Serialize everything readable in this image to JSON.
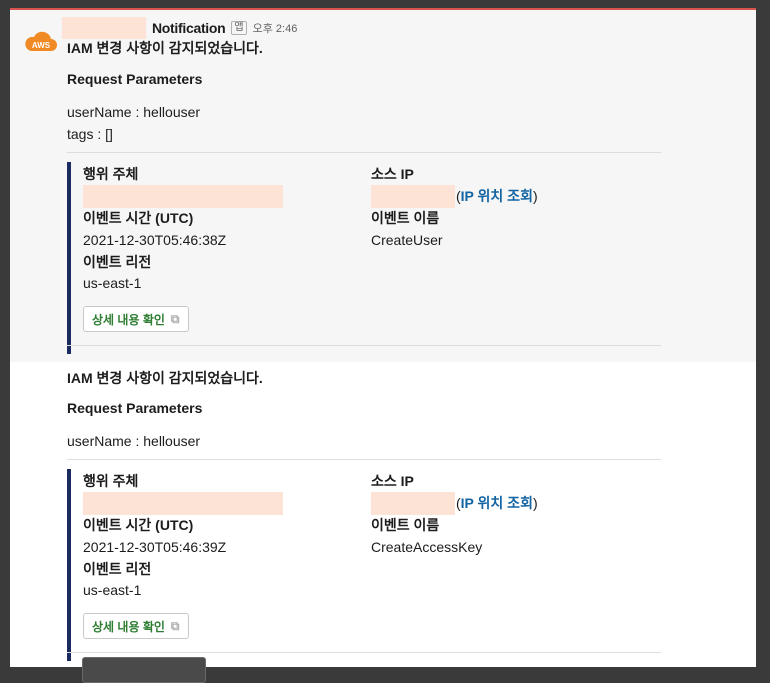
{
  "header": {
    "app_name": "Notification",
    "app_badge": "앱",
    "timestamp": "오후 2:46"
  },
  "avatar": {
    "label": "AWS"
  },
  "messages": [
    {
      "title": "IAM 변경 사항이 감지되었습니다.",
      "params_heading": "Request Parameters",
      "param_lines": [
        "userName : hellouser",
        "tags : []"
      ],
      "fields": {
        "actor_label": "행위 주체",
        "source_ip_label": "소스 IP",
        "ip_lookup_link": "IP 위치 조회",
        "event_time_label": "이벤트 시간 (UTC)",
        "event_time_value": "2021-12-30T05:46:38Z",
        "event_name_label": "이벤트 이름",
        "event_name_value": "CreateUser",
        "event_region_label": "이벤트 리전",
        "event_region_value": "us-east-1"
      },
      "detail_button": "상세 내용 확인"
    },
    {
      "title": "IAM 변경 사항이 감지되었습니다.",
      "params_heading": "Request Parameters",
      "param_lines": [
        "userName : hellouser"
      ],
      "fields": {
        "actor_label": "행위 주체",
        "source_ip_label": "소스 IP",
        "ip_lookup_link": "IP 위치 조회",
        "event_time_label": "이벤트 시간 (UTC)",
        "event_time_value": "2021-12-30T05:46:39Z",
        "event_name_label": "이벤트 이름",
        "event_name_value": "CreateAccessKey",
        "event_region_label": "이벤트 리전",
        "event_region_value": "us-east-1"
      },
      "detail_button": "상세 내용 확인"
    }
  ],
  "colors": {
    "attachment_bar": "#1b2a5f",
    "link": "#1264a3",
    "button_text": "#2e7d32",
    "redaction": "#fde3d6",
    "aws_orange": "#f08a24"
  },
  "icons": {
    "avatar": "aws-cloud-icon",
    "button": "external-link-icon"
  }
}
